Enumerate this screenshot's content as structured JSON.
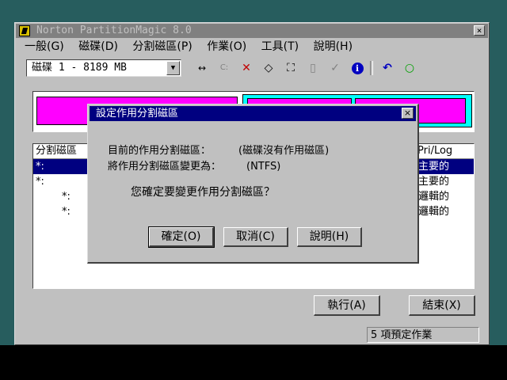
{
  "window": {
    "title": "Norton PartitionMagic 8.0",
    "close_glyph": "×"
  },
  "menu": [
    "一般(G)",
    "磁碟(D)",
    "分割磁區(P)",
    "作業(O)",
    "工具(T)",
    "說明(H)"
  ],
  "toolbar": {
    "disk_select_value": "磁碟 1 - 8189  MB",
    "icons": [
      "resize-icon",
      "copy-c-icon",
      "delete-icon",
      "label-icon",
      "fullscreen-icon",
      "page-icon",
      "check-icon",
      "info-icon",
      "undo-icon",
      "apply-icon"
    ],
    "resize_glyph": "↔",
    "c_glyph": "C:",
    "delete_glyph": "✕",
    "label_glyph": "◇",
    "frame_glyph": "⛶",
    "page_glyph": "▯",
    "check_glyph": "✓",
    "info_glyph": "ℹ",
    "undo_glyph": "↶",
    "apply_glyph": "○"
  },
  "partition_list": {
    "columns": [
      "分割磁區",
      "Pri/Log"
    ],
    "rows": [
      {
        "name": "*:",
        "type": "主要的",
        "selected": true
      },
      {
        "name": "*:",
        "type": "主要的",
        "selected": false
      },
      {
        "name": "*:",
        "type": "邏輯的",
        "selected": false
      },
      {
        "name": "*:",
        "type": "邏輯的",
        "selected": false
      }
    ]
  },
  "buttons": {
    "execute": "執行(A)",
    "exit": "結束(X)"
  },
  "status": {
    "pending": "5 項預定作業"
  },
  "dialog": {
    "title": "設定作用分割磁區",
    "close_glyph": "×",
    "current_label": "目前的作用分割磁區：",
    "current_value": "(磁碟沒有作用磁區)",
    "change_label": "將作用分割磁區變更為：",
    "change_value": "(NTFS)",
    "question": "您確定要變更作用分割磁區？",
    "ok": "確定(O)",
    "cancel": "取消(C)",
    "help": "說明(H)"
  },
  "colors": {
    "desktop": "#275d5e",
    "selection": "#000080",
    "primary_partition": "#ff00ff",
    "extended_partition": "#00ffff"
  }
}
